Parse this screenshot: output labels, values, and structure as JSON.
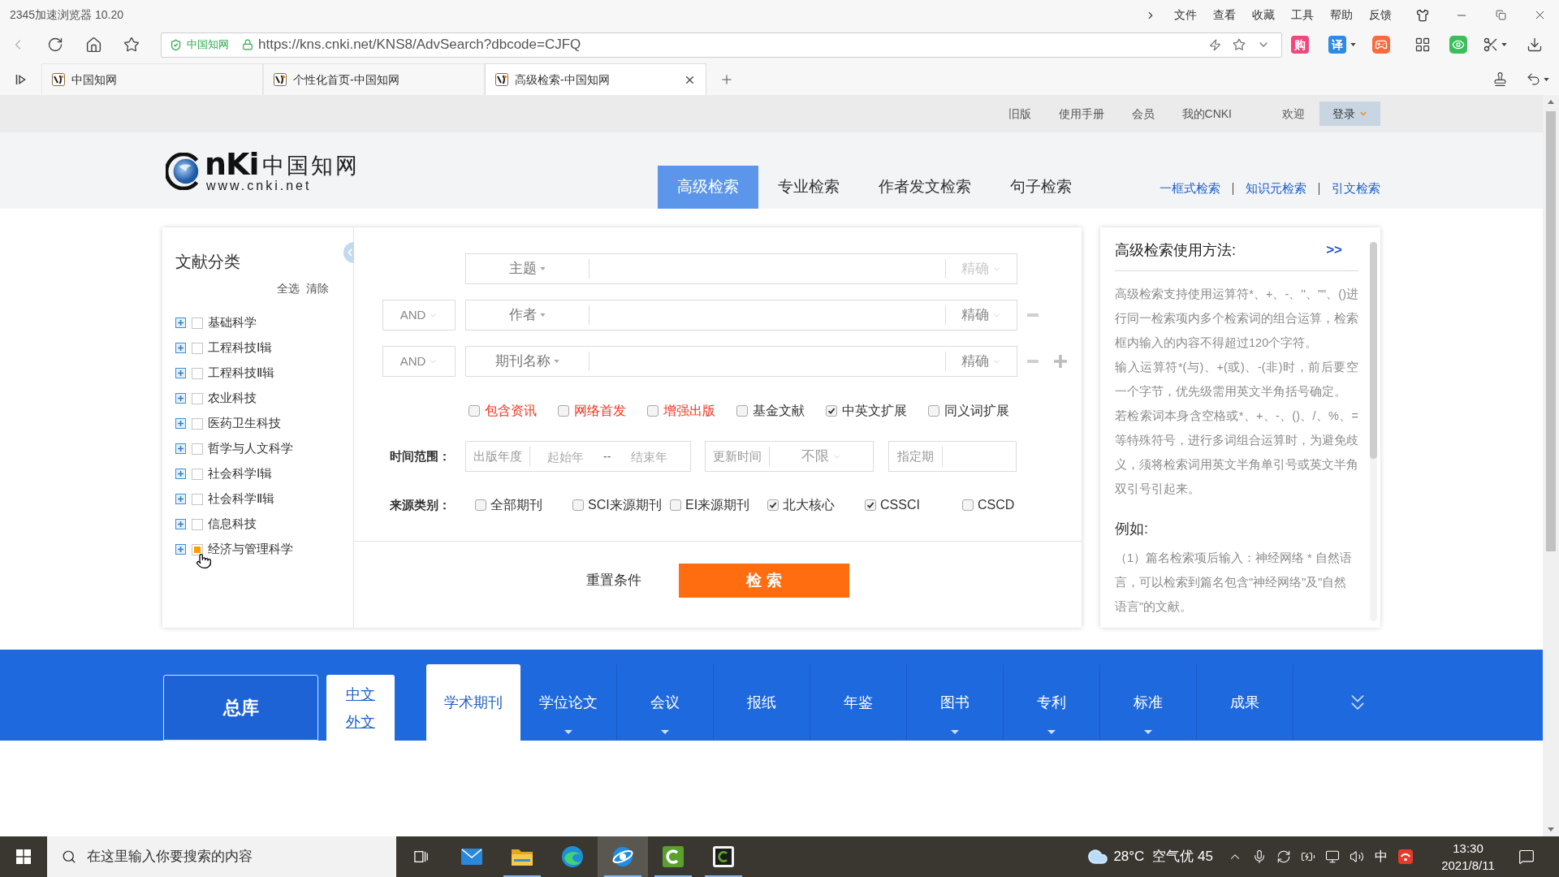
{
  "browser": {
    "title": "2345加速浏览器 10.20",
    "menu": [
      "文件",
      "查看",
      "收藏",
      "工具",
      "帮助",
      "反馈"
    ],
    "site_badge": "中国知网",
    "url": "https://kns.cnki.net/KNS8/AdvSearch?dbcode=CJFQ",
    "shop_label": "购",
    "translate_label": "译",
    "tabs": [
      {
        "title": "中国知网",
        "selected": false
      },
      {
        "title": "个性化首页-中国知网",
        "selected": false
      },
      {
        "title": "高级检索-中国知网",
        "selected": true
      }
    ]
  },
  "site": {
    "top_links": [
      "旧版",
      "使用手册",
      "会员",
      "我的CNKI"
    ],
    "welcome": "欢迎",
    "login": "登录",
    "logo": {
      "letters": "nKi",
      "name": "中国知网",
      "url": "www.cnki.net"
    },
    "search_tabs": [
      {
        "label": "高级检索",
        "selected": true
      },
      {
        "label": "专业检索",
        "selected": false
      },
      {
        "label": "作者发文检索",
        "selected": false
      },
      {
        "label": "句子检索",
        "selected": false
      }
    ],
    "quick_links": [
      "一框式检索",
      "知识元检索",
      "引文检索"
    ]
  },
  "categories": {
    "title": "文献分类",
    "select_all": "全选",
    "clear": "清除",
    "items": [
      {
        "label": "基础科学",
        "checked": false
      },
      {
        "label": "工程科技Ⅰ辑",
        "checked": false
      },
      {
        "label": "工程科技Ⅱ辑",
        "checked": false
      },
      {
        "label": "农业科技",
        "checked": false
      },
      {
        "label": "医药卫生科技",
        "checked": false
      },
      {
        "label": "哲学与人文科学",
        "checked": false
      },
      {
        "label": "社会科学Ⅰ辑",
        "checked": false
      },
      {
        "label": "社会科学Ⅱ辑",
        "checked": false
      },
      {
        "label": "信息科技",
        "checked": false
      },
      {
        "label": "经济与管理科学",
        "checked": true
      }
    ]
  },
  "form": {
    "rows": [
      {
        "field": "主题",
        "match": "精确",
        "match_disabled": true,
        "removable": false,
        "addable": false
      },
      {
        "logic": "AND",
        "field": "作者",
        "match": "精确",
        "match_disabled": false,
        "removable": true,
        "addable": false
      },
      {
        "logic": "AND",
        "field": "期刊名称",
        "match": "精确",
        "match_disabled": false,
        "removable": true,
        "addable": true
      }
    ],
    "options": [
      {
        "label": "包含资讯",
        "checked": false,
        "highlighted": true
      },
      {
        "label": "网络首发",
        "checked": false,
        "highlighted": true
      },
      {
        "label": "增强出版",
        "checked": false,
        "highlighted": true
      },
      {
        "label": "基金文献",
        "checked": false,
        "highlighted": false
      },
      {
        "label": "中英文扩展",
        "checked": true,
        "highlighted": false
      },
      {
        "label": "同义词扩展",
        "checked": false,
        "highlighted": false
      }
    ],
    "time_label": "时间范围：",
    "publish_year": {
      "label": "出版年度",
      "from_placeholder": "起始年",
      "separator": "--",
      "to_placeholder": "结束年"
    },
    "update_time": {
      "label": "更新时间",
      "value": "不限"
    },
    "issue": {
      "label": "指定期"
    },
    "source_label": "来源类别：",
    "sources": [
      {
        "label": "全部期刊",
        "checked": false
      },
      {
        "label": "SCI来源期刊",
        "checked": false
      },
      {
        "label": "EI来源期刊",
        "checked": false
      },
      {
        "label": "北大核心",
        "checked": true
      },
      {
        "label": "CSSCI",
        "checked": true
      },
      {
        "label": "CSCD",
        "checked": false
      }
    ],
    "reset": "重置条件",
    "search": "检 索"
  },
  "help": {
    "title": "高级检索使用方法:",
    "more": ">>",
    "paragraphs": [
      "高级检索支持使用运算符*、+、-、''、\"\"、()进行同一检索项内多个检索词的组合运算，检索框内输入的内容不得超过120个字符。",
      "输入运算符*(与)、+(或)、-(非)时，前后要空一个字节，优先级需用英文半角括号确定。",
      "若检索词本身含空格或*、+、-、()、/、%、=等特殊符号，进行多词组合运算时，为避免歧义，须将检索词用英文半角单引号或英文半角双引号引起来。"
    ],
    "example_title": "例如:",
    "examples": [
      "（1）篇名检索项后输入：神经网络 * 自然语言，可以检索到篇名包含\"神经网络\"及\"自然语言\"的文献。"
    ]
  },
  "databases": {
    "all": "总库",
    "languages": [
      "中文",
      "外文"
    ],
    "tabs": [
      {
        "label": "学术期刊",
        "selected": true,
        "dropdown": false
      },
      {
        "label": "学位论文",
        "selected": false,
        "dropdown": true
      },
      {
        "label": "会议",
        "selected": false,
        "dropdown": true
      },
      {
        "label": "报纸",
        "selected": false,
        "dropdown": false
      },
      {
        "label": "年鉴",
        "selected": false,
        "dropdown": false
      },
      {
        "label": "图书",
        "selected": false,
        "dropdown": true
      },
      {
        "label": "专利",
        "selected": false,
        "dropdown": true
      },
      {
        "label": "标准",
        "selected": false,
        "dropdown": true
      },
      {
        "label": "成果",
        "selected": false,
        "dropdown": false
      }
    ]
  },
  "taskbar": {
    "search_placeholder": "在这里输入你要搜索的内容",
    "apps": [
      {
        "kind": "task-view",
        "running": false,
        "active": false
      },
      {
        "kind": "mail",
        "running": false,
        "active": false
      },
      {
        "kind": "folder",
        "running": true,
        "active": false
      },
      {
        "kind": "swirl",
        "running": false,
        "active": false
      },
      {
        "kind": "orbit",
        "running": true,
        "active": true
      },
      {
        "kind": "green-ring",
        "running": true,
        "active": false
      },
      {
        "kind": "dark-ring",
        "running": true,
        "active": false
      }
    ],
    "weather": "28°C",
    "air_quality": "空气优 45",
    "ime": "中",
    "time": "13:30",
    "date": "2021/8/11"
  }
}
